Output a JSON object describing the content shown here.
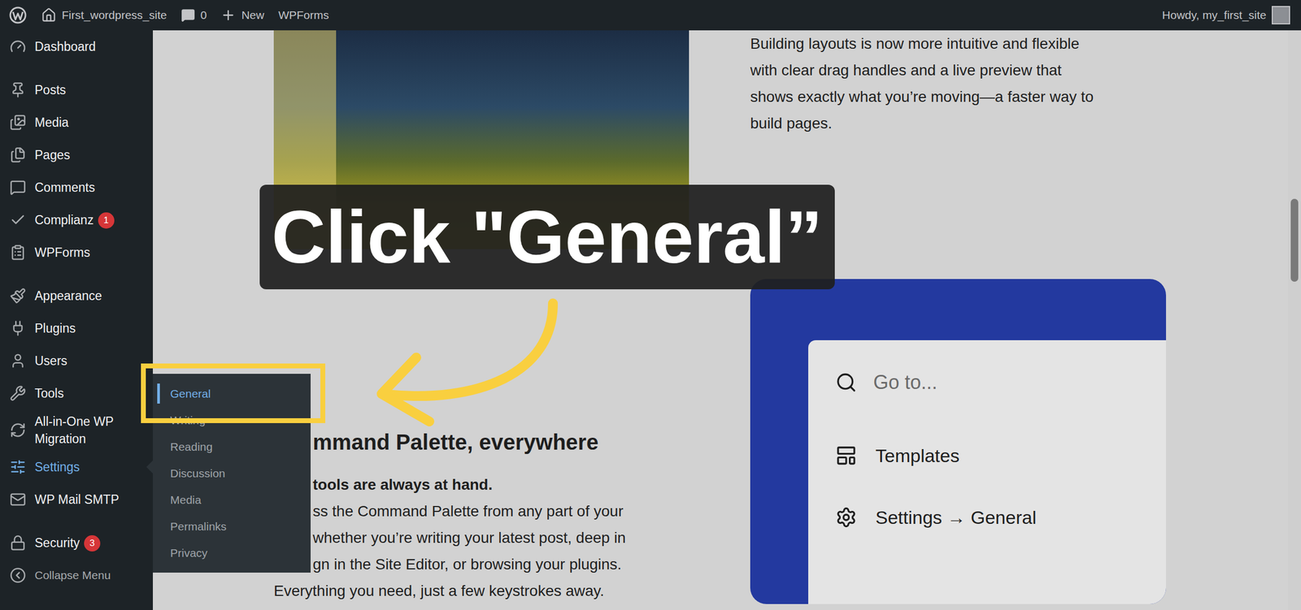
{
  "admin_bar": {
    "site": "First_wordpress_site",
    "comments": "0",
    "new": "New",
    "plugin": "WPForms",
    "greeting": "Howdy, my_first_site"
  },
  "sidebar": {
    "items": [
      {
        "label": "Dashboard",
        "selected": false,
        "badge": ""
      },
      {
        "label": "Posts",
        "selected": false,
        "badge": ""
      },
      {
        "label": "Media",
        "selected": false,
        "badge": ""
      },
      {
        "label": "Pages",
        "selected": false,
        "badge": ""
      },
      {
        "label": "Comments",
        "selected": false,
        "badge": ""
      },
      {
        "label": "Complianz",
        "selected": false,
        "badge": "1"
      },
      {
        "label": "WPForms",
        "selected": false,
        "badge": ""
      },
      {
        "label": "Appearance",
        "selected": false,
        "badge": ""
      },
      {
        "label": "Plugins",
        "selected": false,
        "badge": ""
      },
      {
        "label": "Users",
        "selected": false,
        "badge": ""
      },
      {
        "label": "Tools",
        "selected": false,
        "badge": ""
      },
      {
        "label": "All-in-One WP Migration",
        "selected": false,
        "badge": ""
      },
      {
        "label": "Settings",
        "selected": true,
        "badge": ""
      },
      {
        "label": "WP Mail SMTP",
        "selected": false,
        "badge": ""
      },
      {
        "label": "Security",
        "selected": false,
        "badge": "3"
      }
    ],
    "collapse": "Collapse Menu"
  },
  "submenu": {
    "items": [
      {
        "label": "General",
        "selected": true
      },
      {
        "label": "Writing",
        "selected": false
      },
      {
        "label": "Reading",
        "selected": false
      },
      {
        "label": "Discussion",
        "selected": false
      },
      {
        "label": "Media",
        "selected": false
      },
      {
        "label": "Permalinks",
        "selected": false
      },
      {
        "label": "Privacy",
        "selected": false
      }
    ]
  },
  "content": {
    "paragraph": [
      "Building layouts is now more intuitive and flexible",
      "with clear drag handles and a live preview that",
      "shows exactly what you’re moving—a faster way to",
      "build pages."
    ],
    "section": {
      "heading": "mmand Palette, everywhere",
      "lines": [
        {
          "text": "tools are always at hand.",
          "bold": true,
          "covered": true
        },
        {
          "text": "ss the Command Palette from any part of your",
          "bold": false,
          "covered": true
        },
        {
          "text": "whether you’re writing your latest post, deep in",
          "bold": false,
          "covered": true
        },
        {
          "text": "gn in the Site Editor, or browsing your plugins.",
          "bold": false,
          "covered": true
        },
        {
          "text": "Everything you need, just a few keystrokes away.",
          "bold": false,
          "covered": false
        }
      ]
    },
    "palette": {
      "placeholder": "Go to...",
      "items": [
        {
          "label": "Templates"
        },
        {
          "label": "Settings → General"
        }
      ]
    }
  },
  "callout": {
    "text": "Click \"General”"
  }
}
